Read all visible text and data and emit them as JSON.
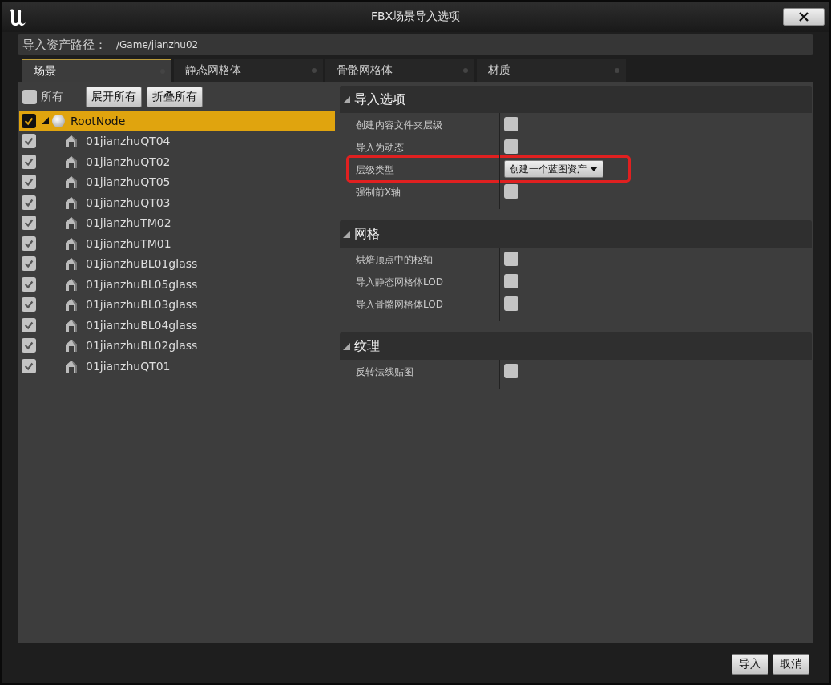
{
  "window": {
    "title": "FBX场景导入选项"
  },
  "path_bar": {
    "label": "导入资产路径：",
    "value": "/Game/jianzhu02"
  },
  "tabs": [
    {
      "label": "场景",
      "selected": true
    },
    {
      "label": "静态网格体",
      "selected": false
    },
    {
      "label": "骨骼网格体",
      "selected": false
    },
    {
      "label": "材质",
      "selected": false
    }
  ],
  "tree_toolbar": {
    "all_label": "所有",
    "all_checked": false,
    "buttons": [
      "展开所有",
      "折叠所有"
    ]
  },
  "tree": [
    {
      "label": "RootNode",
      "checked": true,
      "selected": true,
      "expanded": true,
      "children": [
        {
          "label": "01jianzhuQT04",
          "checked": true,
          "selected": false
        },
        {
          "label": "01jianzhuQT02",
          "checked": true,
          "selected": false
        },
        {
          "label": "01jianzhuQT05",
          "checked": true,
          "selected": false
        },
        {
          "label": "01jianzhuQT03",
          "checked": true,
          "selected": false
        },
        {
          "label": "01jianzhuTM02",
          "checked": true,
          "selected": false
        },
        {
          "label": "01jianzhuTM01",
          "checked": true,
          "selected": false
        },
        {
          "label": "01jianzhuBL01glass",
          "checked": true,
          "selected": false
        },
        {
          "label": "01jianzhuBL05glass",
          "checked": true,
          "selected": false
        },
        {
          "label": "01jianzhuBL03glass",
          "checked": true,
          "selected": false
        },
        {
          "label": "01jianzhuBL04glass",
          "checked": true,
          "selected": false
        },
        {
          "label": "01jianzhuBL02glass",
          "checked": true,
          "selected": false
        },
        {
          "label": "01jianzhuQT01",
          "checked": true,
          "selected": false
        }
      ]
    }
  ],
  "sections": [
    {
      "title": "导入选项",
      "expanded": true,
      "rows": [
        {
          "kind": "checkbox",
          "label": "创建内容文件夹层级",
          "checked": false
        },
        {
          "kind": "checkbox",
          "label": "导入为动态",
          "checked": false
        },
        {
          "kind": "dropdown",
          "label": "层级类型",
          "value": "创建一个蓝图资产",
          "highlighted": true
        },
        {
          "kind": "checkbox",
          "label": "强制前X轴",
          "checked": false
        }
      ]
    },
    {
      "title": "网格",
      "expanded": true,
      "rows": [
        {
          "kind": "checkbox",
          "label": "烘焙顶点中的枢轴",
          "checked": false
        },
        {
          "kind": "checkbox",
          "label": "导入静态网格体LOD",
          "checked": false
        },
        {
          "kind": "checkbox",
          "label": "导入骨骼网格体LOD",
          "checked": false
        }
      ]
    },
    {
      "title": "纹理",
      "expanded": true,
      "rows": [
        {
          "kind": "checkbox",
          "label": "反转法线贴图",
          "checked": false
        }
      ]
    }
  ],
  "buttons": [
    "导入",
    "取消"
  ]
}
